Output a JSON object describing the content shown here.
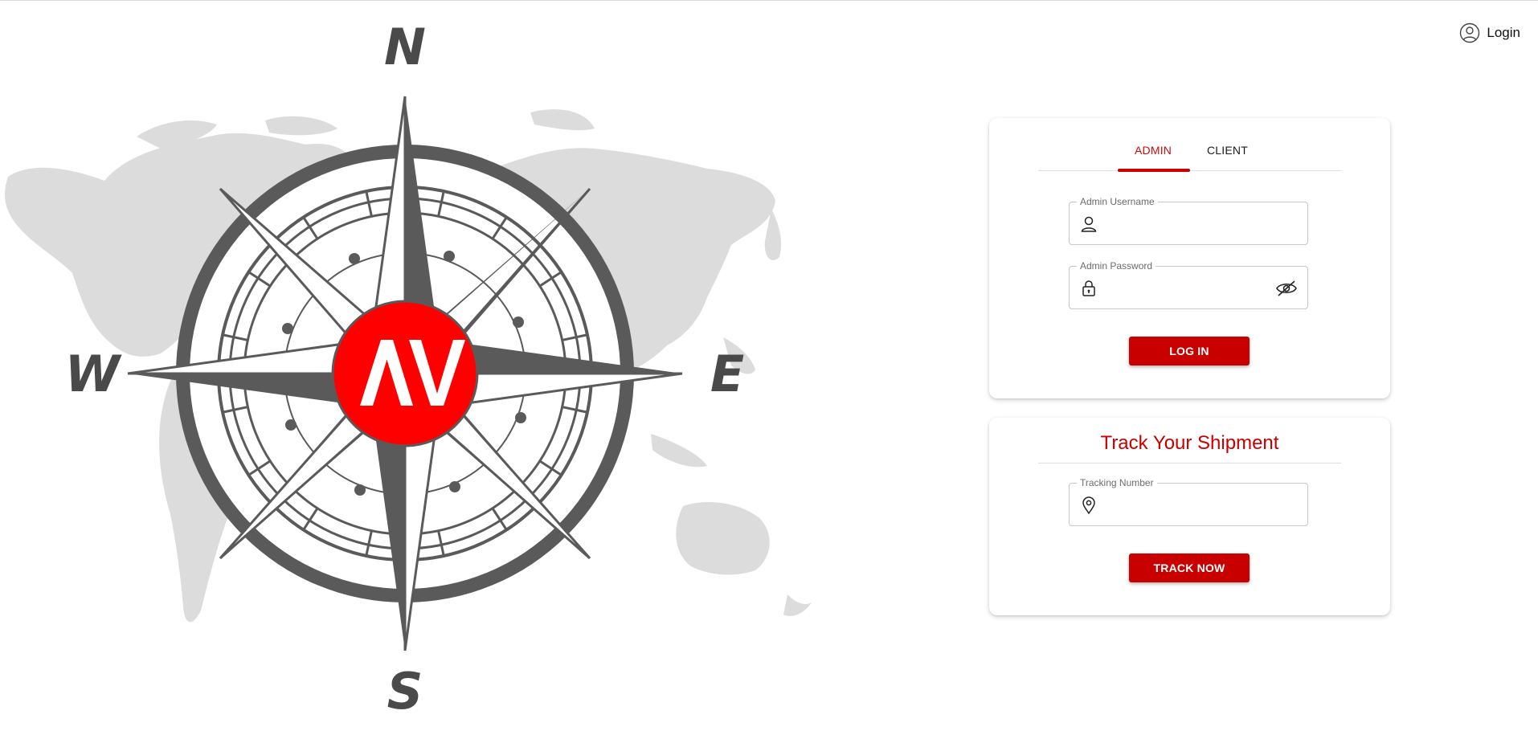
{
  "header": {
    "login_label": "Login",
    "login_icon": "user-circle-icon"
  },
  "illustration": {
    "compass": {
      "north": "N",
      "south": "S",
      "east": "E",
      "west": "W",
      "logo_text": "AV"
    },
    "logo_color": "#ff0000",
    "compass_color": "#5a5a5a",
    "map_color": "#dcdcdc"
  },
  "login_card": {
    "tabs": [
      {
        "label": "ADMIN",
        "active": true
      },
      {
        "label": "CLIENT",
        "active": false
      }
    ],
    "username": {
      "label": "Admin Username",
      "value": "",
      "icon": "user-icon"
    },
    "password": {
      "label": "Admin Password",
      "value": "",
      "icon": "lock-icon",
      "toggle_icon": "eye-off-icon"
    },
    "submit_label": "LOG IN"
  },
  "track_card": {
    "title": "Track Your Shipment",
    "tracking": {
      "label": "Tracking Number",
      "value": "",
      "icon": "location-pin-icon"
    },
    "submit_label": "TRACK NOW"
  },
  "colors": {
    "accent": "#c80000",
    "tab_active": "#d10a0a",
    "border": "#c6c6c6"
  }
}
